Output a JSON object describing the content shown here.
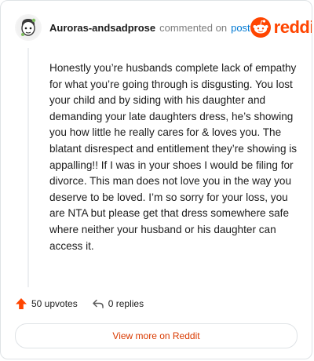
{
  "comment": {
    "username": "Auroras-andsadprose",
    "action_text": "commented on",
    "post_link": "post",
    "body": "Honestly you’re husbands complete lack of empathy for what you’re going through is disgusting. You lost your child and by siding with his daughter and demanding your late daughters dress, he’s showing you how little he really cares for & loves you. The blatant disrespect and entitlement they’re showing is appalling!! If I was in your shoes I would be filing for divorce. This man does not love you in the way you deserve to be loved. I’m so sorry for your loss, you are NTA but please get that dress somewhere safe where neither your husband or his daughter can access it.",
    "upvotes_label": "50 upvotes",
    "replies_label": "0 replies"
  },
  "brand": {
    "name": "reddit",
    "color": "#ff4500",
    "icon": "reddit-logo-icon"
  },
  "footer": {
    "view_more_label": "View more on Reddit"
  },
  "colors": {
    "accent": "#ff4500",
    "link": "#0079d3",
    "view_more_text": "#d93a00"
  }
}
